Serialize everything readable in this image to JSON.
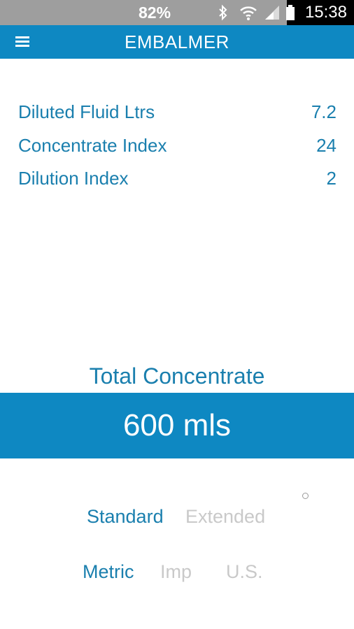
{
  "status_bar": {
    "battery_percent": "82%",
    "time": "15:38",
    "icons": [
      "bluetooth-icon",
      "wifi-icon",
      "signal-icon",
      "battery-icon"
    ]
  },
  "app_bar": {
    "title": "EMBALMER",
    "menu_icon": "hamburger-menu-icon"
  },
  "values": [
    {
      "label": "Diluted Fluid Ltrs",
      "value": "7.2"
    },
    {
      "label": "Concentrate Index",
      "value": "24"
    },
    {
      "label": "Dilution Index",
      "value": "2"
    }
  ],
  "total": {
    "title": "Total Concentrate",
    "value": "600 mls"
  },
  "mode_options": {
    "standard": "Standard",
    "extended": "Extended",
    "selected": "Standard"
  },
  "unit_options": {
    "metric": "Metric",
    "imp": "Imp",
    "us": "U.S.",
    "selected": "Metric"
  },
  "colors": {
    "accent": "#0e88c2",
    "text_accent": "#1a7fae",
    "inactive": "#c9c9c9"
  }
}
